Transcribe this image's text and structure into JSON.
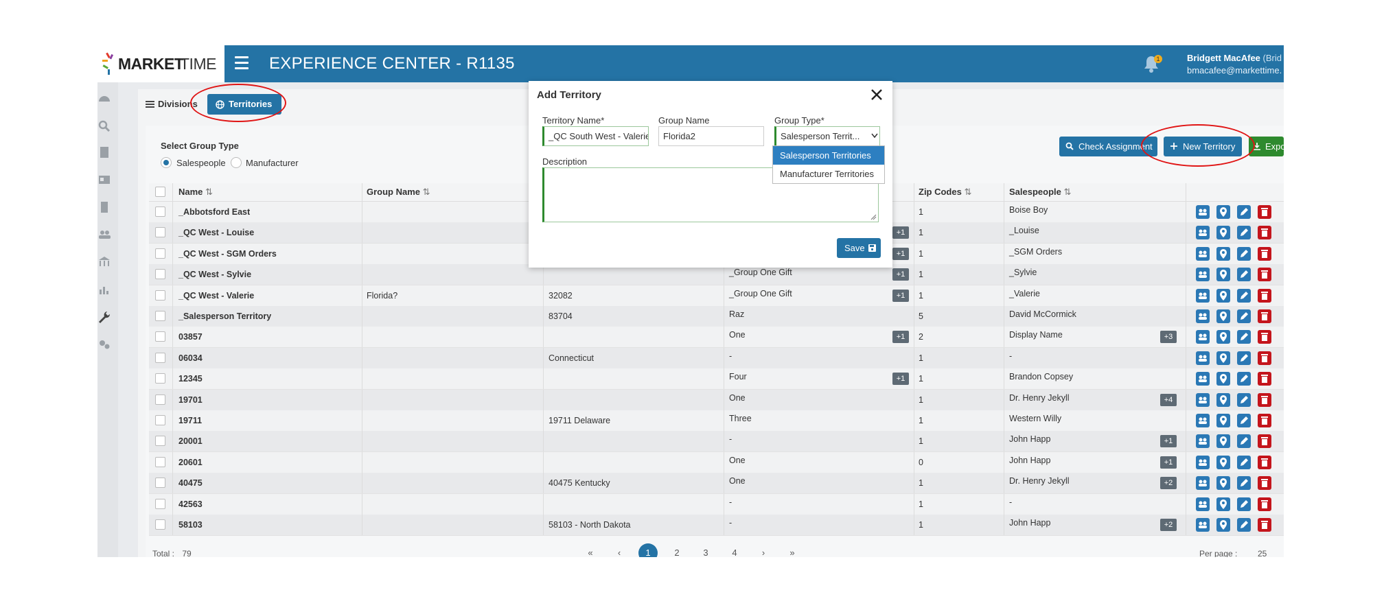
{
  "app": {
    "logo_market": "MARKET",
    "logo_time": "TIME",
    "title": "EXPERIENCE CENTER - R1135",
    "notification_count": "1",
    "user_name": "Bridgett MacAfee",
    "user_name_suffix": "(Brid",
    "user_email": "bmacafee@markettime."
  },
  "tabs": {
    "divisions": "Divisions",
    "territories": "Territories"
  },
  "filters": {
    "group_type_label": "Select Group Type",
    "opt_salespeople": "Salespeople",
    "opt_manufacturer": "Manufacturer"
  },
  "actions": {
    "check_assignment": "Check Assignment",
    "new_territory": "New Territory",
    "export": "Export"
  },
  "table": {
    "headers": {
      "name": "Name",
      "group_name": "Group Name",
      "zip_codes": "Zip Codes",
      "salespeople": "Salespeople"
    },
    "sort_icons": {
      "name": "⇅",
      "group_name": "⇅",
      "zip_codes": "⇅",
      "salespeople": "⇅"
    },
    "rows": [
      {
        "name": "_Abbotsford East",
        "group": "",
        "col3": "",
        "col4": "",
        "col4_plus": "",
        "zips": "1",
        "sales": "Boise Boy",
        "sales_plus": ""
      },
      {
        "name": "_QC West - Louise",
        "group": "",
        "col3": "",
        "col4": "",
        "col4_plus": "+1",
        "zips": "1",
        "sales": "_Louise",
        "sales_plus": ""
      },
      {
        "name": "_QC West - SGM Orders",
        "group": "",
        "col3": "",
        "col4": "",
        "col4_plus": "+1",
        "zips": "1",
        "sales": "_SGM Orders",
        "sales_plus": ""
      },
      {
        "name": "_QC West - Sylvie",
        "group": "",
        "col3": "",
        "col4": "_Group One Gift",
        "col4_plus": "+1",
        "zips": "1",
        "sales": "_Sylvie",
        "sales_plus": ""
      },
      {
        "name": "_QC West - Valerie",
        "group": "Florida?",
        "col3": "32082",
        "col4": "_Group One Gift",
        "col4_plus": "+1",
        "zips": "1",
        "sales": "_Valerie",
        "sales_plus": ""
      },
      {
        "name": "_Salesperson Territory",
        "group": "",
        "col3": "83704",
        "col4": "Raz",
        "col4_plus": "",
        "zips": "5",
        "sales": "David McCormick",
        "sales_plus": ""
      },
      {
        "name": "03857",
        "group": "",
        "col3": "",
        "col4": "One",
        "col4_plus": "+1",
        "zips": "2",
        "sales": "Display Name",
        "sales_plus": "+3"
      },
      {
        "name": "06034",
        "group": "",
        "col3": "Connecticut",
        "col4": "-",
        "col4_plus": "",
        "zips": "1",
        "sales": "-",
        "sales_plus": ""
      },
      {
        "name": "12345",
        "group": "",
        "col3": "",
        "col4": "Four",
        "col4_plus": "+1",
        "zips": "1",
        "sales": "Brandon Copsey",
        "sales_plus": ""
      },
      {
        "name": "19701",
        "group": "",
        "col3": "",
        "col4": "One",
        "col4_plus": "",
        "zips": "1",
        "sales": "Dr. Henry Jekyll",
        "sales_plus": "+4"
      },
      {
        "name": "19711",
        "group": "",
        "col3": "19711 Delaware",
        "col4": "Three",
        "col4_plus": "",
        "zips": "1",
        "sales": "Western Willy",
        "sales_plus": ""
      },
      {
        "name": "20001",
        "group": "",
        "col3": "",
        "col4": "-",
        "col4_plus": "",
        "zips": "1",
        "sales": "John Happ",
        "sales_plus": "+1"
      },
      {
        "name": "20601",
        "group": "",
        "col3": "",
        "col4": "One",
        "col4_plus": "",
        "zips": "0",
        "sales": "John Happ",
        "sales_plus": "+1"
      },
      {
        "name": "40475",
        "group": "",
        "col3": "40475 Kentucky",
        "col4": "One",
        "col4_plus": "",
        "zips": "1",
        "sales": "Dr. Henry Jekyll",
        "sales_plus": "+2"
      },
      {
        "name": "42563",
        "group": "",
        "col3": "",
        "col4": "-",
        "col4_plus": "",
        "zips": "1",
        "sales": "-",
        "sales_plus": ""
      },
      {
        "name": "58103",
        "group": "",
        "col3": "58103 - North Dakota",
        "col4": "-",
        "col4_plus": "",
        "zips": "1",
        "sales": "John Happ",
        "sales_plus": "+2"
      }
    ]
  },
  "footer": {
    "total_label": "Total :",
    "total_value": "79",
    "pages": [
      "«",
      "‹",
      "1",
      "2",
      "3",
      "4",
      "›",
      "»"
    ],
    "active_page": "1",
    "per_page_label": "Per page :",
    "per_page_value": "25"
  },
  "modal": {
    "title": "Add Territory",
    "territory_name_label": "Territory Name*",
    "territory_name_value": "_QC South West - Valerie",
    "group_name_label": "Group Name",
    "group_name_value": "Florida2",
    "group_type_label": "Group Type*",
    "group_type_value": "Salesperson Territ...",
    "description_label": "Description",
    "save_label": "Save",
    "dropdown_options": [
      "Salesperson Territories",
      "Manufacturer Territories"
    ]
  },
  "colors": {
    "brand_blue": "#2473a5",
    "danger_red": "#c4151c",
    "valid_green": "#2e8a2e",
    "highlight_circle": "#e01414"
  }
}
